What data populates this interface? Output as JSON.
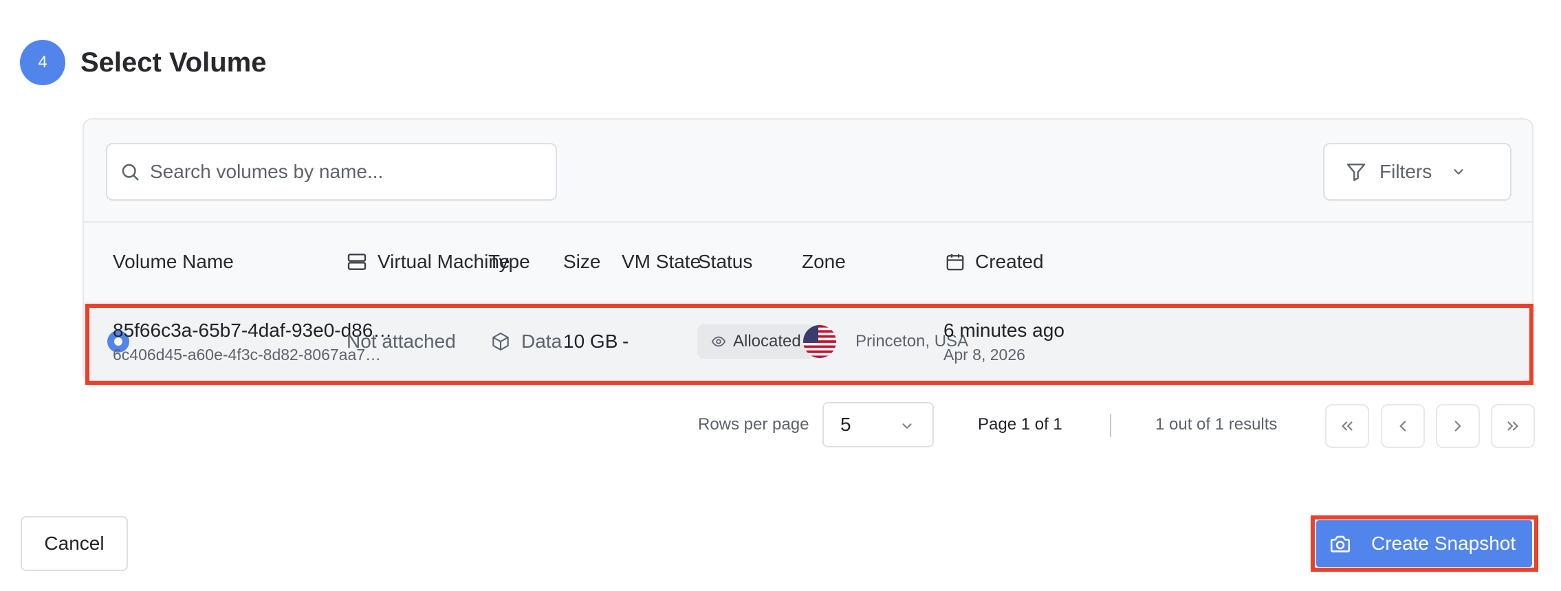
{
  "step": {
    "number": "4",
    "title": "Select Volume"
  },
  "search": {
    "placeholder": "Search volumes by name..."
  },
  "filters": {
    "label": "Filters"
  },
  "columns": {
    "volume_name": "Volume Name",
    "virtual_machine": "Virtual Machine",
    "type": "Type",
    "size": "Size",
    "vm_state": "VM State",
    "status": "Status",
    "zone": "Zone",
    "created": "Created"
  },
  "rows": [
    {
      "selected": true,
      "name": "85f66c3a-65b7-4daf-93e0-d86…",
      "id": "6c406d45-a60e-4f3c-8d82-8067aa7…",
      "virtual_machine": "Not attached",
      "type": "Data",
      "size": "10 GB",
      "vm_state": "-",
      "status": "Allocated",
      "zone": "Princeton, USA",
      "created_relative": "6 minutes ago",
      "created_date": "Apr 8, 2026"
    }
  ],
  "pagination": {
    "rows_per_page_label": "Rows per page",
    "rows_per_page_value": "5",
    "page_info": "Page 1 of 1",
    "results": "1 out of 1 results"
  },
  "actions": {
    "cancel": "Cancel",
    "create": "Create Snapshot"
  },
  "colors": {
    "accent": "#5285ec",
    "highlight": "#e8412c"
  },
  "icons": [
    "search-icon",
    "filter-icon",
    "chevron-down-icon",
    "server-icon",
    "calendar-icon",
    "box-icon",
    "eye-icon",
    "us-flag-icon",
    "camera-icon",
    "chevrons-left-icon",
    "chevron-left-icon",
    "chevron-right-icon",
    "chevrons-right-icon"
  ]
}
